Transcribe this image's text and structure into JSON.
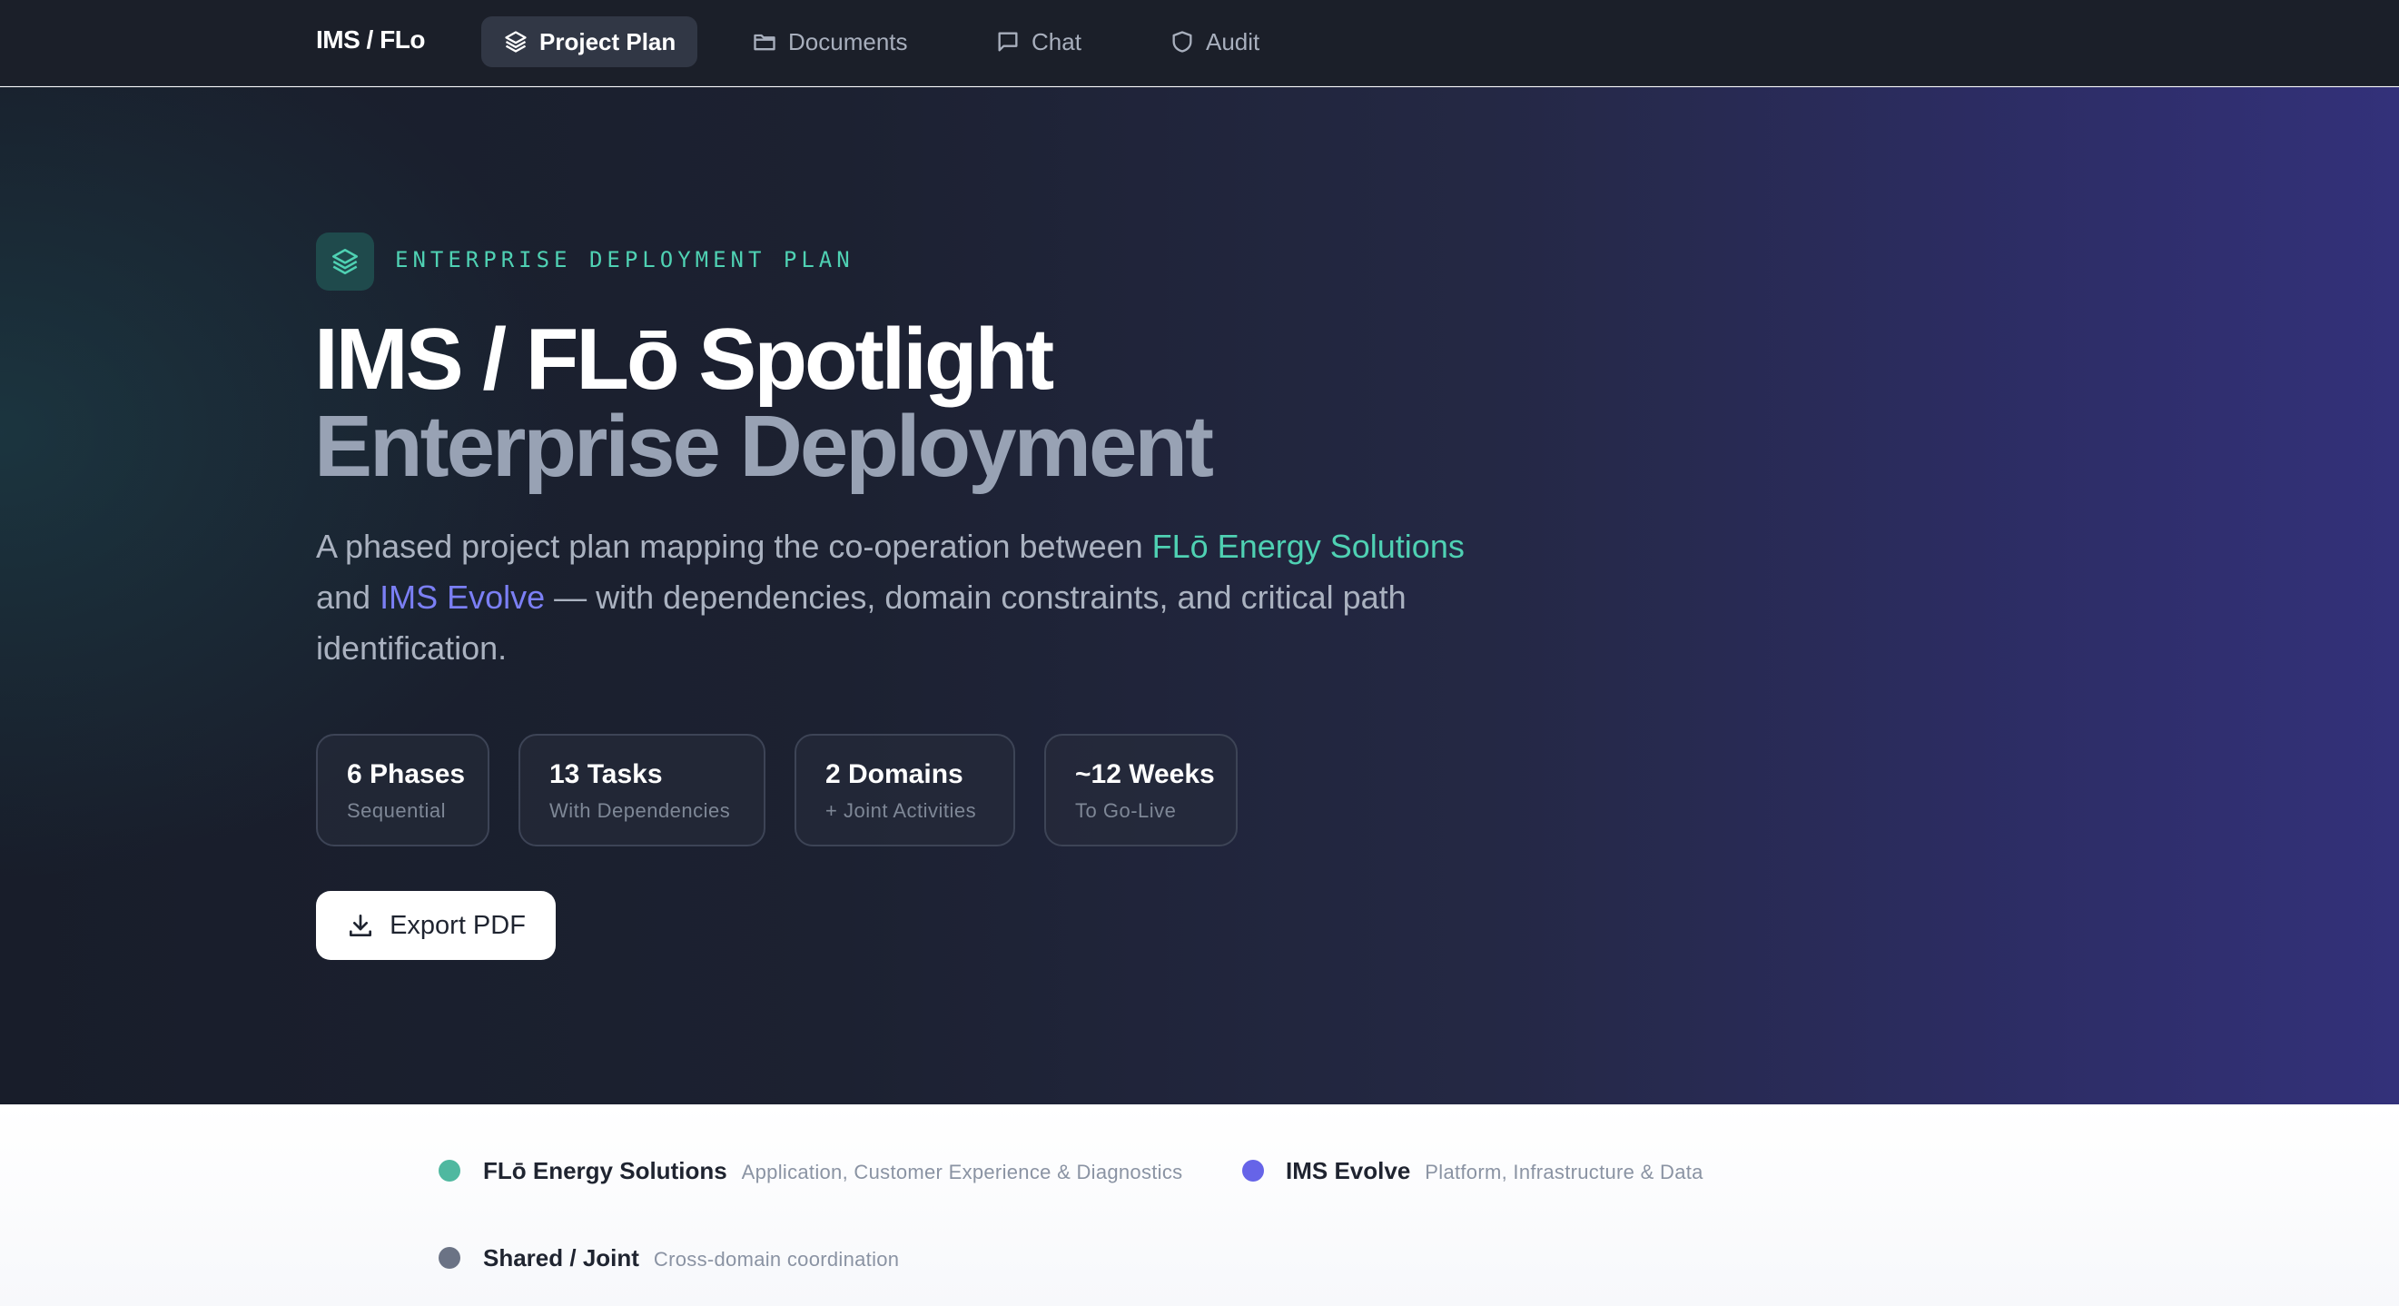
{
  "nav": {
    "brand": "IMS / FLo",
    "items": [
      {
        "label": "Project Plan",
        "icon": "layers-icon",
        "active": true
      },
      {
        "label": "Documents",
        "icon": "folder-icon"
      },
      {
        "label": "Chat",
        "icon": "chat-icon"
      },
      {
        "label": "Audit",
        "icon": "shield-icon"
      }
    ]
  },
  "hero": {
    "eyebrow": "ENTERPRISE DEPLOYMENT PLAN",
    "title_line1": "IMS / FLō Spotlight",
    "title_line2": "Enterprise Deployment",
    "lead": {
      "part1": "A phased project plan mapping the co-operation between ",
      "highlight1": "FLō Energy Solutions",
      "part2": " and ",
      "highlight2": "IMS Evolve",
      "part3": " — with dependencies, domain constraints, and critical path identification."
    },
    "stats": [
      {
        "value": "6 Phases",
        "sub": "Sequential"
      },
      {
        "value": "13 Tasks",
        "sub": "With Dependencies"
      },
      {
        "value": "2 Domains",
        "sub": "+ Joint Activities"
      },
      {
        "value": "~12 Weeks",
        "sub": "To Go-Live"
      }
    ],
    "export_label": "Export PDF"
  },
  "legend": [
    {
      "name": "FLō Energy Solutions",
      "desc": "Application, Customer Experience & Diagnostics",
      "color": "#4fb8a0"
    },
    {
      "name": "IMS Evolve",
      "desc": "Platform, Infrastructure & Data",
      "color": "#6664e8"
    },
    {
      "name": "Shared / Joint",
      "desc": "Cross-domain coordination",
      "color": "#6b7385"
    }
  ],
  "colors": {
    "accent_teal": "#4fd1b3",
    "accent_indigo": "#7b7ff5",
    "topbar_bg": "#1b1f29"
  }
}
